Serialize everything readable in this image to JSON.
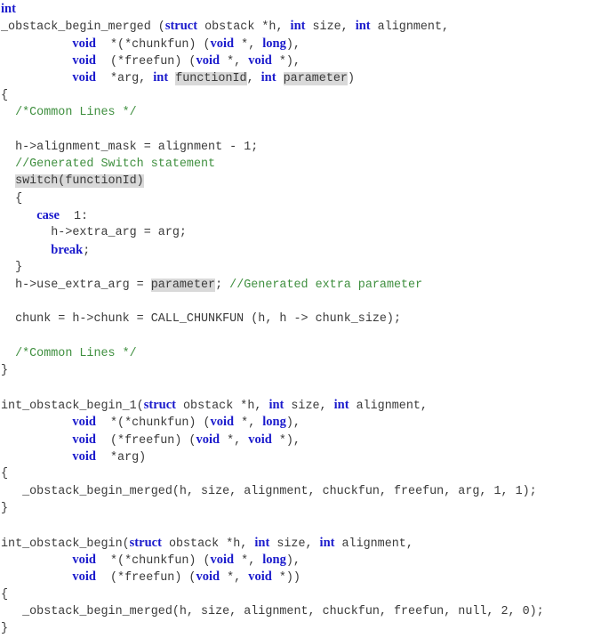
{
  "code": {
    "lines": [
      [
        {
          "t": "int",
          "c": "kw"
        }
      ],
      [
        {
          "t": "_obstack_begin_merged ("
        },
        {
          "t": "struct",
          "c": "kw"
        },
        {
          "t": " obstack *h, "
        },
        {
          "t": "int",
          "c": "kw"
        },
        {
          "t": " size, "
        },
        {
          "t": "int",
          "c": "kw"
        },
        {
          "t": " alignment,"
        }
      ],
      [
        {
          "t": "          "
        },
        {
          "t": "void",
          "c": "kw"
        },
        {
          "t": "  *(*chunkfun) ("
        },
        {
          "t": "void",
          "c": "kw"
        },
        {
          "t": " *, "
        },
        {
          "t": "long",
          "c": "kw"
        },
        {
          "t": "),"
        }
      ],
      [
        {
          "t": "          "
        },
        {
          "t": "void",
          "c": "kw"
        },
        {
          "t": "  (*freefun) ("
        },
        {
          "t": "void",
          "c": "kw"
        },
        {
          "t": " *, "
        },
        {
          "t": "void",
          "c": "kw"
        },
        {
          "t": " *),"
        }
      ],
      [
        {
          "t": "          "
        },
        {
          "t": "void",
          "c": "kw"
        },
        {
          "t": "  *arg, "
        },
        {
          "t": "int",
          "c": "kw"
        },
        {
          "t": " "
        },
        {
          "t": "functionId",
          "c": "hl"
        },
        {
          "t": ", "
        },
        {
          "t": "int",
          "c": "kw"
        },
        {
          "t": " "
        },
        {
          "t": "parameter",
          "c": "hl"
        },
        {
          "t": ")"
        }
      ],
      [
        {
          "t": "{"
        }
      ],
      [
        {
          "t": "  "
        },
        {
          "t": "/*Common Lines */",
          "c": "cm"
        }
      ],
      [
        {
          "t": ""
        }
      ],
      [
        {
          "t": "  h->alignment_mask = alignment - 1;"
        }
      ],
      [
        {
          "t": "  "
        },
        {
          "t": "//Generated Switch statement",
          "c": "cm"
        }
      ],
      [
        {
          "t": "  "
        },
        {
          "t": "switch(functionId)",
          "c": "hl"
        }
      ],
      [
        {
          "t": "  {"
        }
      ],
      [
        {
          "t": "     "
        },
        {
          "t": "case",
          "c": "kw"
        },
        {
          "t": "  1:"
        }
      ],
      [
        {
          "t": "       h->extra_arg = arg;"
        }
      ],
      [
        {
          "t": "       "
        },
        {
          "t": "break",
          "c": "kw"
        },
        {
          "t": ";"
        }
      ],
      [
        {
          "t": "  }"
        }
      ],
      [
        {
          "t": "  h->use_extra_arg = "
        },
        {
          "t": "parameter",
          "c": "hl"
        },
        {
          "t": "; "
        },
        {
          "t": "//Generated extra parameter",
          "c": "cm"
        }
      ],
      [
        {
          "t": ""
        }
      ],
      [
        {
          "t": "  chunk = h->chunk = CALL_CHUNKFUN (h, h -> chunk_size);"
        }
      ],
      [
        {
          "t": ""
        }
      ],
      [
        {
          "t": "  "
        },
        {
          "t": "/*Common Lines */",
          "c": "cm"
        }
      ],
      [
        {
          "t": "}"
        }
      ],
      [
        {
          "t": ""
        }
      ],
      [
        {
          "t": "int_obstack_begin_1("
        },
        {
          "t": "struct",
          "c": "kw"
        },
        {
          "t": " obstack *h, "
        },
        {
          "t": "int",
          "c": "kw"
        },
        {
          "t": " size, "
        },
        {
          "t": "int",
          "c": "kw"
        },
        {
          "t": " alignment,"
        }
      ],
      [
        {
          "t": "          "
        },
        {
          "t": "void",
          "c": "kw"
        },
        {
          "t": "  *(*chunkfun) ("
        },
        {
          "t": "void",
          "c": "kw"
        },
        {
          "t": " *, "
        },
        {
          "t": "long",
          "c": "kw"
        },
        {
          "t": "),"
        }
      ],
      [
        {
          "t": "          "
        },
        {
          "t": "void",
          "c": "kw"
        },
        {
          "t": "  (*freefun) ("
        },
        {
          "t": "void",
          "c": "kw"
        },
        {
          "t": " *, "
        },
        {
          "t": "void",
          "c": "kw"
        },
        {
          "t": " *),"
        }
      ],
      [
        {
          "t": "          "
        },
        {
          "t": "void",
          "c": "kw"
        },
        {
          "t": "  *arg)"
        }
      ],
      [
        {
          "t": "{"
        }
      ],
      [
        {
          "t": "   _obstack_begin_merged(h, size, alignment, chuckfun, freefun, arg, 1, 1);"
        }
      ],
      [
        {
          "t": "}"
        }
      ],
      [
        {
          "t": ""
        }
      ],
      [
        {
          "t": "int_obstack_begin("
        },
        {
          "t": "struct",
          "c": "kw"
        },
        {
          "t": " obstack *h, "
        },
        {
          "t": "int",
          "c": "kw"
        },
        {
          "t": " size, "
        },
        {
          "t": "int",
          "c": "kw"
        },
        {
          "t": " alignment,"
        }
      ],
      [
        {
          "t": "          "
        },
        {
          "t": "void",
          "c": "kw"
        },
        {
          "t": "  *(*chunkfun) ("
        },
        {
          "t": "void",
          "c": "kw"
        },
        {
          "t": " *, "
        },
        {
          "t": "long",
          "c": "kw"
        },
        {
          "t": "),"
        }
      ],
      [
        {
          "t": "          "
        },
        {
          "t": "void",
          "c": "kw"
        },
        {
          "t": "  (*freefun) ("
        },
        {
          "t": "void",
          "c": "kw"
        },
        {
          "t": " *, "
        },
        {
          "t": "void",
          "c": "kw"
        },
        {
          "t": " *))"
        }
      ],
      [
        {
          "t": "{"
        }
      ],
      [
        {
          "t": "   _obstack_begin_merged(h, size, alignment, chuckfun, freefun, null, 2, 0);"
        }
      ],
      [
        {
          "t": "}"
        }
      ]
    ]
  }
}
